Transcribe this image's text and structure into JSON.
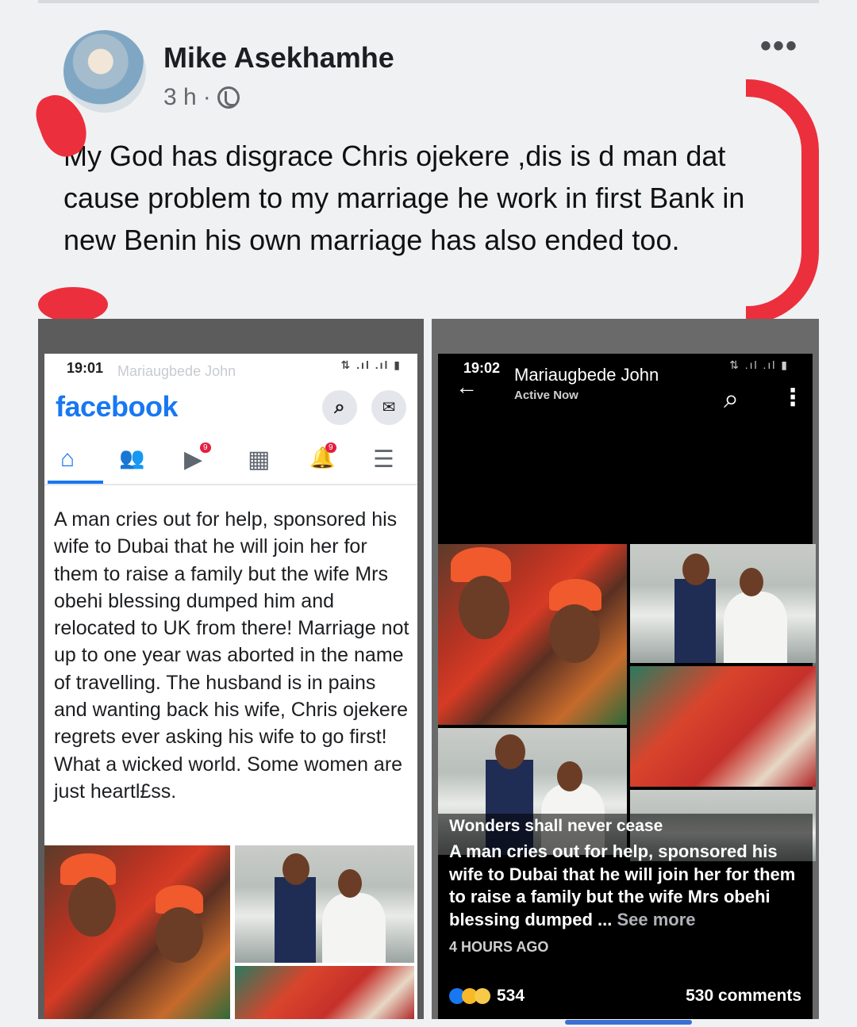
{
  "post": {
    "author": "Mike Asekhamhe",
    "time": "3 h",
    "separator": "·",
    "more_icon": "•••",
    "text": "My God has disgrace Chris ojekere ,dis is d man dat cause problem to my marriage he work in first Bank in new Benin his own marriage has also ended too."
  },
  "colors": {
    "fb_blue": "#1877f2",
    "annotation_red": "#ec2f3c"
  },
  "left_screenshot": {
    "status_time": "19:01",
    "status_name": "Mariaugbede John",
    "status_icons": "⇅ .ıl .ıl ▮",
    "logo": "facebook",
    "search_icon": "⌕",
    "messenger_icon": "✉",
    "nav": {
      "home": "⌂",
      "friends": "👥",
      "watch": "▶",
      "marketplace": "▦",
      "notifications": "🔔",
      "menu": "☰"
    },
    "story": "A man cries out for help, sponsored his wife to Dubai that he will join her for them to raise a family  but the wife Mrs obehi blessing dumped him and relocated to UK from there! Marriage not up to one year was aborted in the name of travelling. The husband is in pains and wanting back his wife, Chris ojekere regrets ever asking his wife to go first! What a wicked world. Some women are just heartl£ss."
  },
  "right_screenshot": {
    "status_time": "19:02",
    "status_icons": "⇅ .ıl .ıl ▮",
    "name": "Mariaugbede John",
    "status": "Active Now",
    "back_icon": "←",
    "search_icon": "⌕",
    "more_icon": "⋮",
    "caption_title": "Wonders shall never cease",
    "caption_body": "A man cries out for help, sponsored his wife to Dubai that he will join her for them to raise a family  but the wife Mrs obehi blessing dumped ...",
    "see_more": "See more",
    "posted": "4 HOURS AGO",
    "reactions": "534",
    "comments": "530 comments"
  }
}
